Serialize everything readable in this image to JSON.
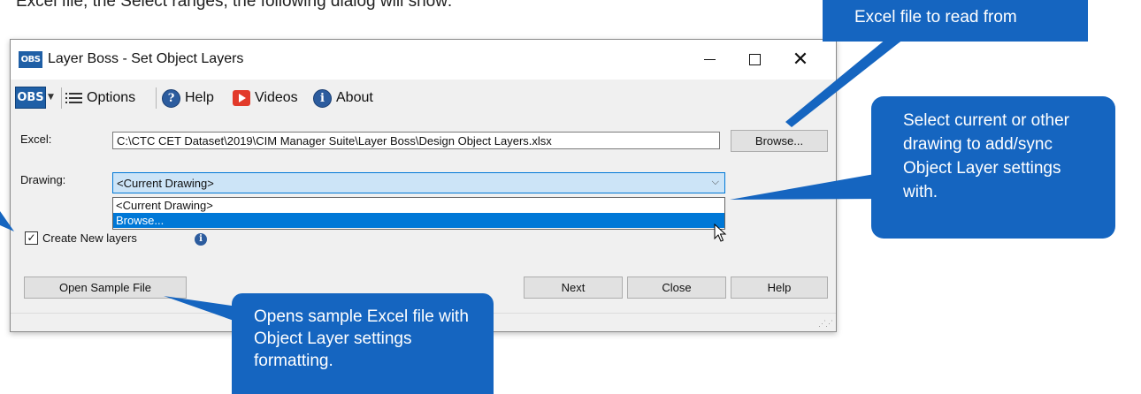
{
  "intro_text": "Excel file, the Select ranges, the following dialog will show:",
  "window": {
    "title": "Layer Boss - Set Object Layers",
    "logo_small": "OBS",
    "controls": [
      "minimize",
      "maximize",
      "close"
    ]
  },
  "toolbar": {
    "logo": "OBS",
    "options_label": "Options",
    "help_label": "Help",
    "videos_label": "Videos",
    "about_label": "About"
  },
  "form": {
    "excel_label": "Excel:",
    "excel_value": "C:\\CTC CET Dataset\\2019\\CIM Manager Suite\\Layer Boss\\Design Object Layers.xlsx",
    "browse_label": "Browse...",
    "drawing_label": "Drawing:",
    "drawing_selected": "<Current Drawing>",
    "drawing_options": [
      "<Current Drawing>",
      "Browse..."
    ],
    "drawing_highlighted": "Browse...",
    "create_new_layers_label": "Create New layers",
    "create_new_layers_checked": true
  },
  "buttons": {
    "open_sample": "Open Sample File",
    "next": "Next",
    "close": "Close",
    "help": "Help"
  },
  "callouts": {
    "excel": "Excel file to read from",
    "drawing": "Select current or other drawing to add/sync Object Layer settings with.",
    "sample": "Opens sample Excel file with Object Layer settings formatting."
  },
  "icons": {
    "help": "help-icon",
    "videos": "video-play-icon",
    "about": "info-icon",
    "options": "list-icon"
  },
  "colors": {
    "callout": "#1565c0",
    "selection": "#0078d7",
    "combo_focus": "#cce4f7"
  }
}
